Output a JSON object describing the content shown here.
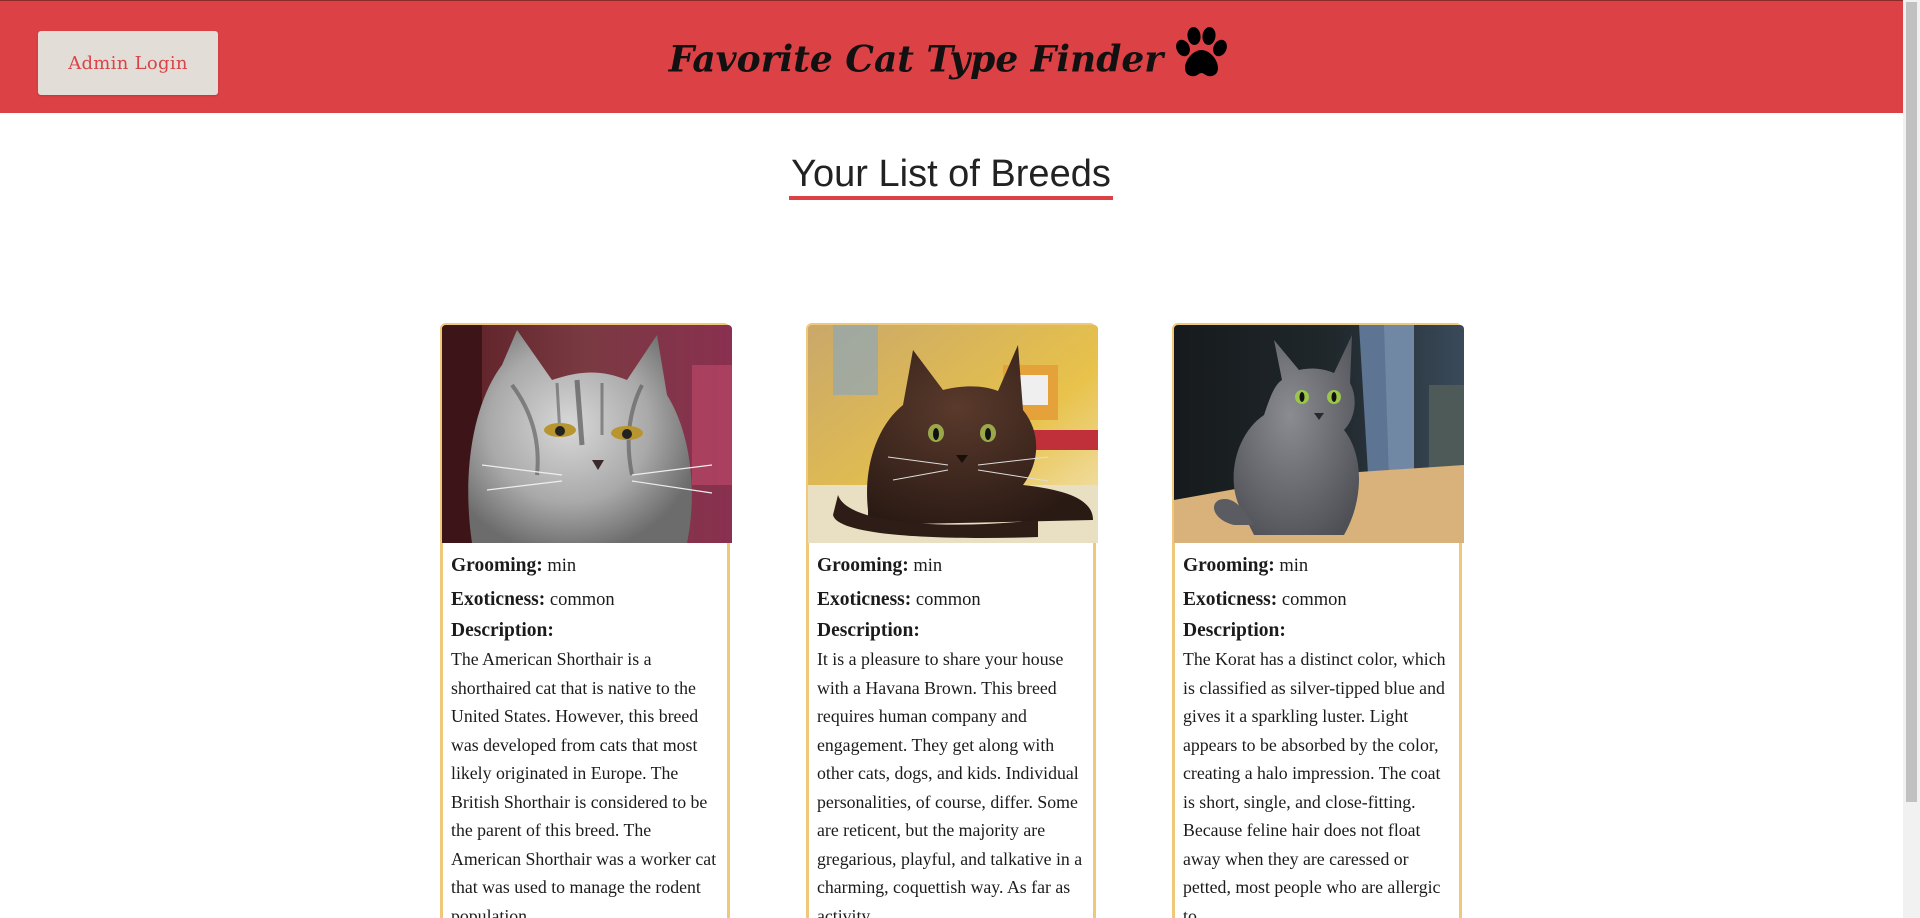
{
  "header": {
    "admin_button_label": "Admin Login",
    "site_title": "Favorite Cat Type Finder",
    "title_icon": "paw-icon",
    "background_color": "#dc4145"
  },
  "page": {
    "heading": "Your List of Breeds",
    "accent_color": "#dc4145",
    "card_border_color": "#f0c87a"
  },
  "cards": [
    {
      "image_icon": "cat-photo-american-shorthair",
      "grooming_label": "Grooming:",
      "grooming_value": "min",
      "exoticness_label": "Exoticness:",
      "exoticness_value": "common",
      "description_label": "Description:",
      "description": "The American Shorthair is a shorthaired cat that is native to the United States. However, this breed was developed from cats that most likely originated in Europe. The British Shorthair is considered to be the parent of this breed. The American Shorthair was a worker cat that was used to manage the rodent population."
    },
    {
      "image_icon": "cat-photo-havana-brown",
      "grooming_label": "Grooming:",
      "grooming_value": "min",
      "exoticness_label": "Exoticness:",
      "exoticness_value": "common",
      "description_label": "Description:",
      "description": "It is a pleasure to share your house with a Havana Brown. This breed requires human company and engagement. They get along with other cats, dogs, and kids. Individual personalities, of course, differ. Some are reticent, but the majority are gregarious, playful, and talkative in a charming, coquettish way. As far as activity"
    },
    {
      "image_icon": "cat-photo-korat",
      "grooming_label": "Grooming:",
      "grooming_value": "min",
      "exoticness_label": "Exoticness:",
      "exoticness_value": "common",
      "description_label": "Description:",
      "description": "The Korat has a distinct color, which is classified as silver-tipped blue and gives it a sparkling luster. Light appears to be absorbed by the color, creating a halo impression. The coat is short, single, and close-fitting. Because feline hair does not float away when they are caressed or petted, most people who are allergic to"
    }
  ]
}
